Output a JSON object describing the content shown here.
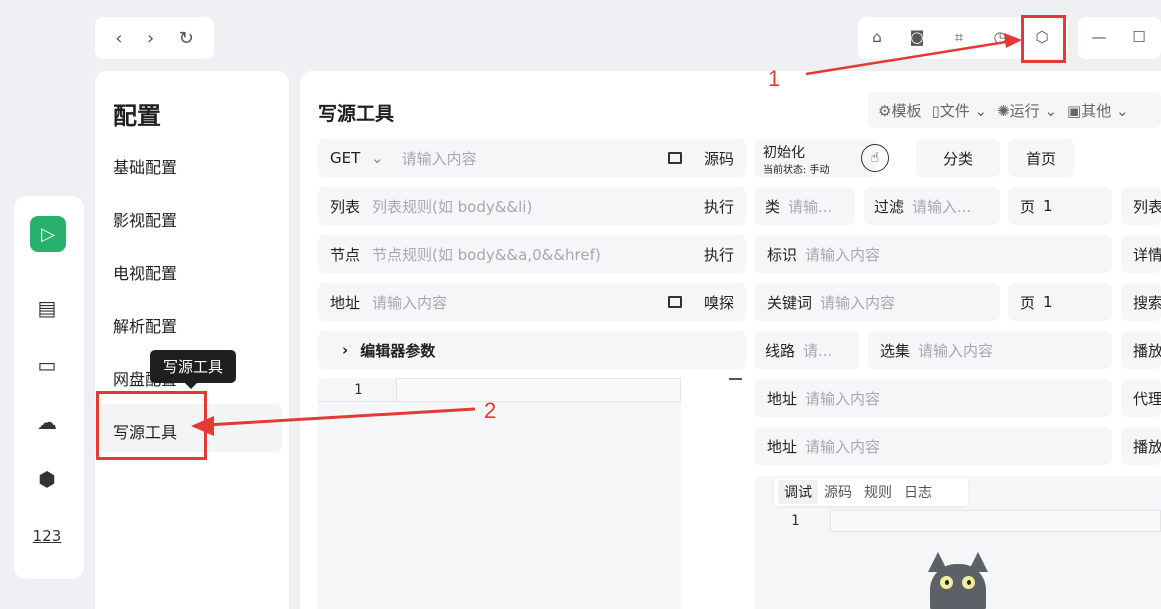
{
  "nav": {
    "back": "‹",
    "forward": "›",
    "refresh": "↻"
  },
  "sidebar": {
    "apps": [
      "logo",
      "film",
      "tv",
      "cloud",
      "scan",
      "123"
    ],
    "label_123": "123"
  },
  "config": {
    "title": "配置",
    "items": [
      "基础配置",
      "影视配置",
      "电视配置",
      "解析配置",
      "网盘配置",
      "写源工具"
    ],
    "tooltip": "写源工具"
  },
  "main": {
    "title": "写源工具",
    "menu": [
      "模板",
      "文件",
      "运行",
      "其他"
    ],
    "left": {
      "method": "GET",
      "url_placeholder": "请输入内容",
      "source_btn": "源码",
      "list_label": "列表",
      "list_placeholder": "列表规则(如 body&&li)",
      "list_exec": "执行",
      "node_label": "节点",
      "node_placeholder": "节点规则(如 body&&a,0&&href)",
      "node_exec": "执行",
      "addr_label": "地址",
      "addr_placeholder": "请输入内容",
      "sniff_btn": "嗅探",
      "editor_params": "编辑器参数",
      "line_no": "1"
    },
    "right": {
      "init_title": "初始化",
      "init_status": "当前状态: 手动",
      "category_btn": "分类",
      "home_btn": "首页",
      "class_label": "类",
      "class_placeholder": "请输...",
      "filter_label": "过滤",
      "filter_placeholder": "请输入...",
      "page_label": "页",
      "page_value": "1",
      "col_list": "列表",
      "ident_label": "标识",
      "ident_placeholder": "请输入内容",
      "col_detail": "详情",
      "keyword_label": "关键词",
      "keyword_placeholder": "请输入内容",
      "page2_label": "页",
      "page2_value": "1",
      "col_search": "搜索",
      "route_label": "线路",
      "route_placeholder": "请...",
      "episode_label": "选集",
      "episode_placeholder": "请输入内容",
      "col_play": "播放",
      "addr1_label": "地址",
      "addr1_placeholder": "请输入内容",
      "col_proxy": "代理",
      "addr2_label": "地址",
      "addr2_placeholder": "请输入内容",
      "col_player": "播放器",
      "tabs": [
        "调试",
        "源码",
        "规则",
        "日志"
      ],
      "line_no": "1"
    }
  },
  "annotations": {
    "one": "1",
    "two": "2"
  },
  "colors": {
    "accent": "#e53935",
    "logo": "#28b06d"
  }
}
